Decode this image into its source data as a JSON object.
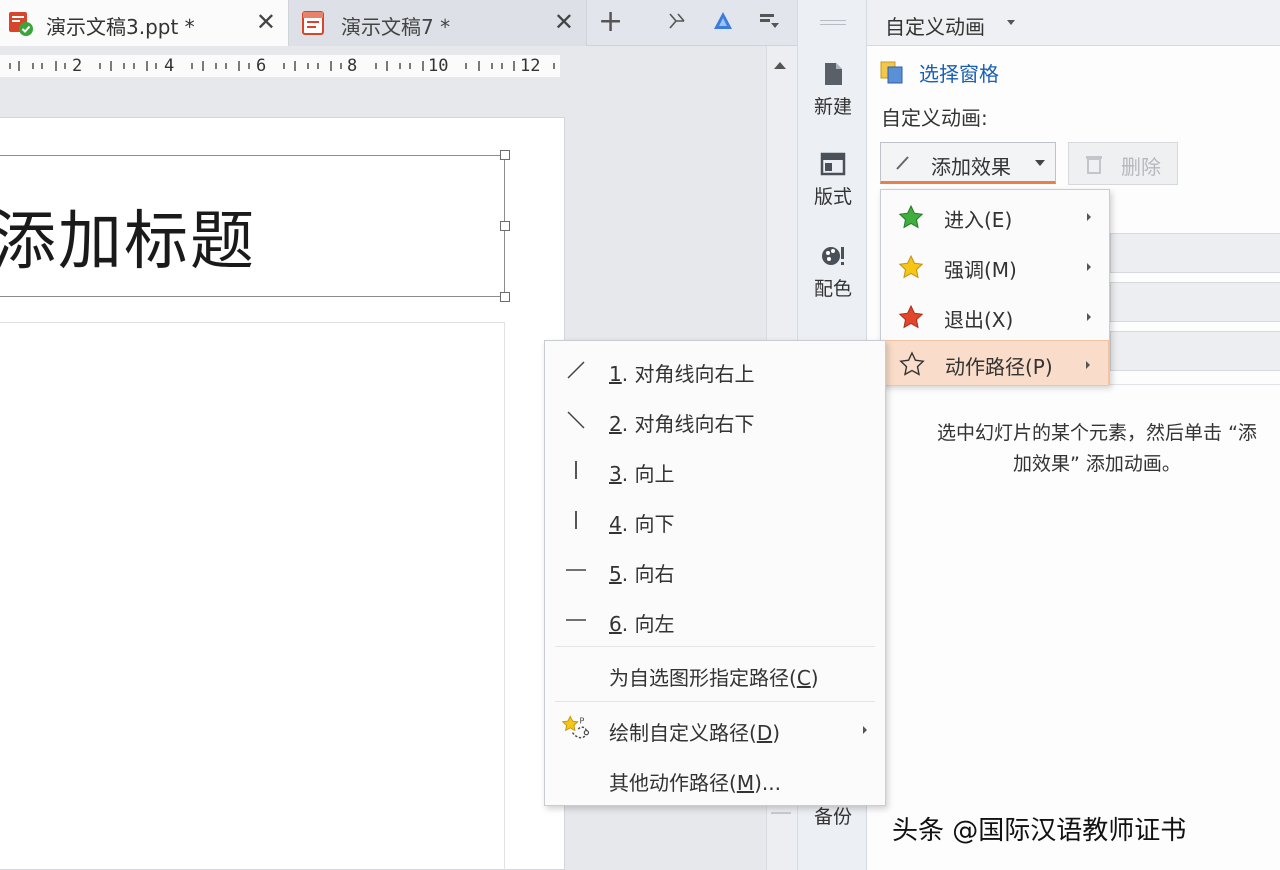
{
  "tabs": [
    {
      "label": "演示文稿3.ppt *",
      "close": "✕",
      "active": true
    },
    {
      "label": "演示文稿7 *",
      "close": "✕",
      "active": false
    }
  ],
  "toolbar": {
    "add_tab": "+",
    "icons": [
      "skin-icon",
      "cloud-sync-icon",
      "dropdown-menu-icon"
    ]
  },
  "ruler": {
    "labels": [
      "2",
      "4",
      "6",
      "8",
      "10",
      "12"
    ]
  },
  "slide": {
    "title_placeholder": "添加标题"
  },
  "side_strip": {
    "buttons": [
      {
        "label": "新建",
        "icon": "new-slide-icon"
      },
      {
        "label": "版式",
        "icon": "layout-icon"
      },
      {
        "label": "配色",
        "icon": "color-scheme-icon"
      },
      {
        "label": "备份",
        "icon": "backup-icon"
      }
    ]
  },
  "task_pane": {
    "title": "自定义动画",
    "select_pane_link": "选择窗格",
    "custom_anim_label": "自定义动画:",
    "add_effect_label": "添加效果",
    "delete_label": "删除",
    "hint_line1": "选中幻灯片的某个元素，然后单击 “添",
    "hint_line2": "加效果” 添加动画。"
  },
  "effects_menu": {
    "items": [
      {
        "label": "进入(E)",
        "icon": "green-star-icon"
      },
      {
        "label": "强调(M)",
        "icon": "yellow-star-icon"
      },
      {
        "label": "退出(X)",
        "icon": "red-star-icon"
      },
      {
        "label": "动作路径(P)",
        "icon": "outline-star-icon",
        "highlighted": true
      }
    ]
  },
  "paths_menu": {
    "items": [
      {
        "num": "1",
        "text": ". 对角线向右上",
        "icon": "diagonal-up-right-icon"
      },
      {
        "num": "2",
        "text": ". 对角线向右下",
        "icon": "diagonal-down-right-icon"
      },
      {
        "num": "3",
        "text": ". 向上",
        "icon": "vertical-up-icon"
      },
      {
        "num": "4",
        "text": ". 向下",
        "icon": "vertical-down-icon"
      },
      {
        "num": "5",
        "text": ". 向右",
        "icon": "horizontal-right-icon"
      },
      {
        "num": "6",
        "text": ". 向左",
        "icon": "horizontal-left-icon"
      }
    ],
    "assign_path": {
      "pre": "为自选图形指定路径(",
      "key": "C",
      "post": ")"
    },
    "draw_custom": {
      "pre": "绘制自定义路径(",
      "key": "D",
      "post": ")"
    },
    "more_paths": {
      "pre": "其他动作路径(",
      "key": "M",
      "post": ")..."
    }
  },
  "watermark": "头条 @国际汉语教师证书"
}
